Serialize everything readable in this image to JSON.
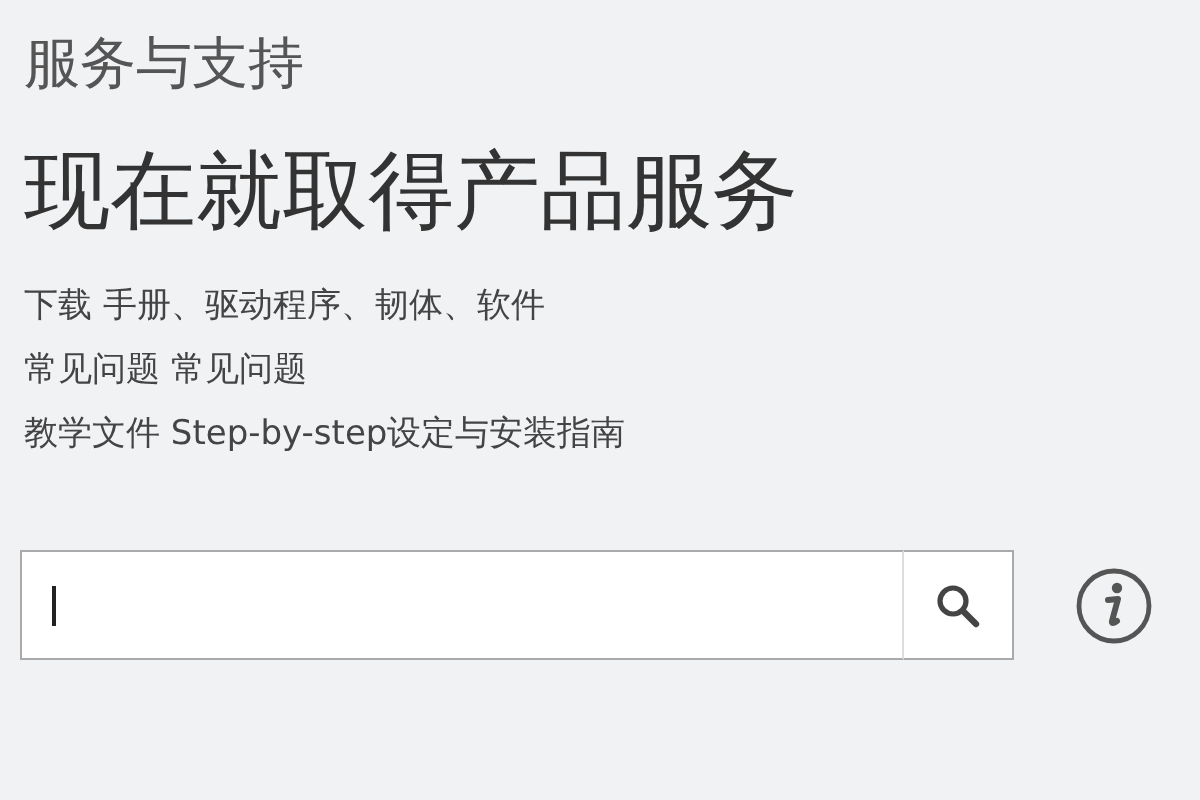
{
  "header": {
    "subtitle": "服务与支持",
    "title": "现在就取得产品服务"
  },
  "links": [
    "下载 手册、驱动程序、韧体、软件",
    "常见问题 常见问题",
    "教学文件 Step-by-step设定与安装指南"
  ],
  "search": {
    "focused": true
  }
}
